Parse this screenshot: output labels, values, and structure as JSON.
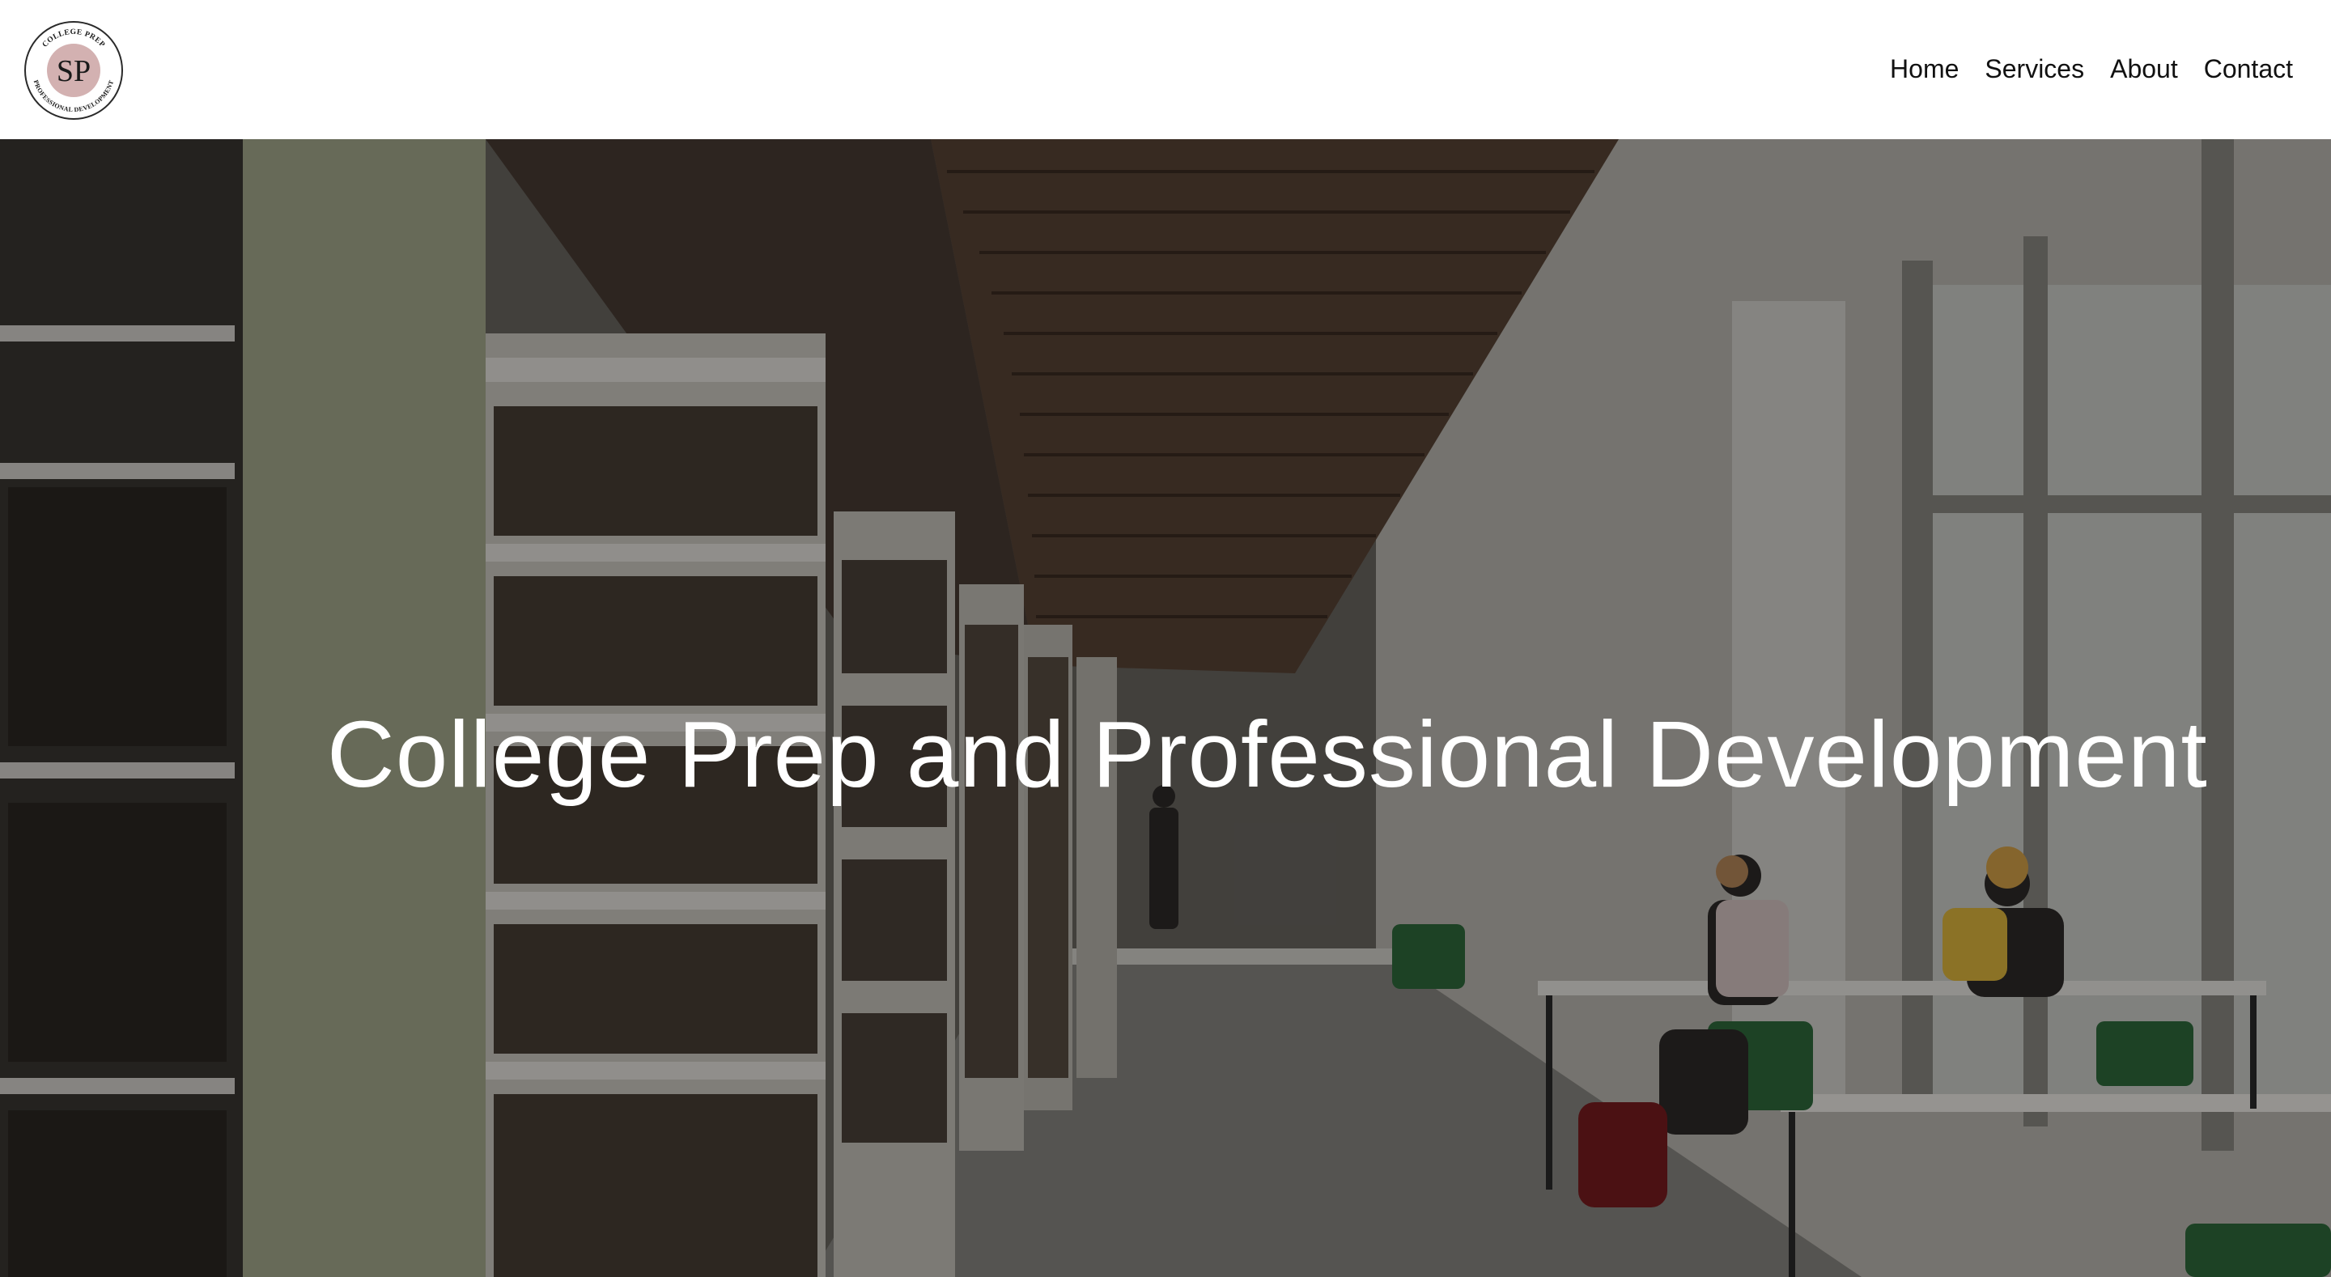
{
  "brand": {
    "monogram": "SP",
    "ring_text_top": "COLLEGE PREP",
    "ring_text_bottom": "PROFESSIONAL DEVELOPMENT",
    "monogram_bg": "#d3b1b1"
  },
  "nav": {
    "items": [
      {
        "label": "Home"
      },
      {
        "label": "Services"
      },
      {
        "label": "About"
      },
      {
        "label": "Contact"
      }
    ]
  },
  "hero": {
    "title": "College Prep and Professional Development",
    "background_image": "library-interior-with-bookshelves-and-students-studying"
  },
  "colors": {
    "header_bg": "#ffffff",
    "nav_text": "#111111",
    "hero_text": "#ffffff"
  }
}
